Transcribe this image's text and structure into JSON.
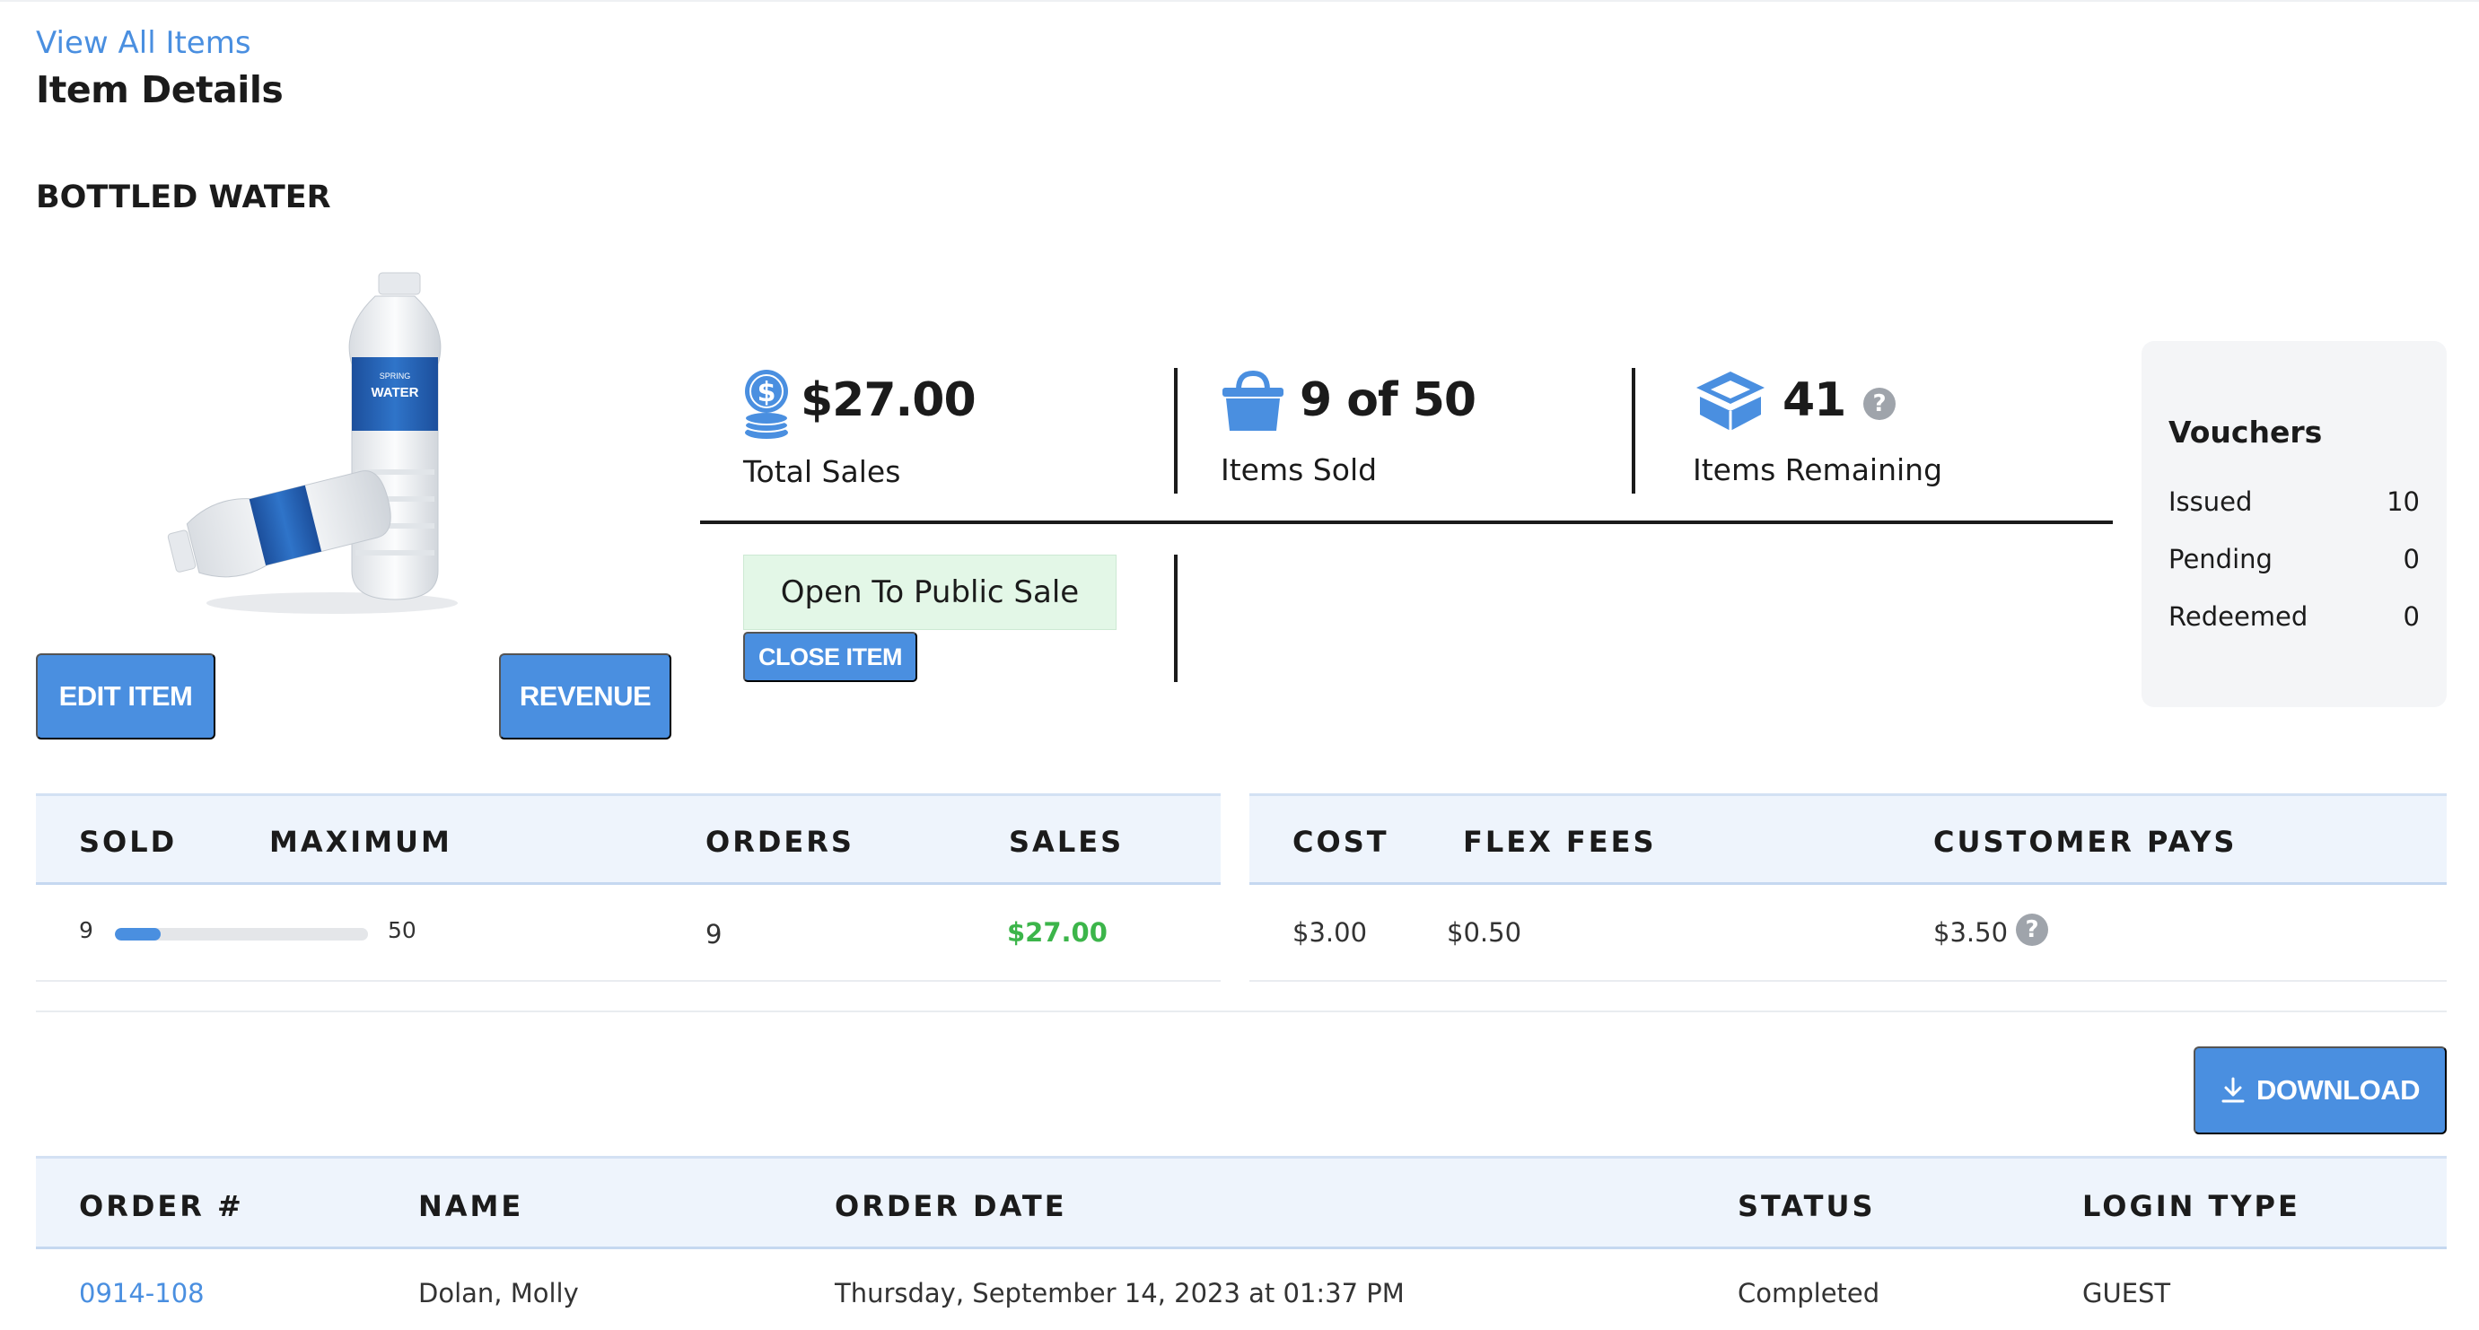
{
  "header": {
    "back_link": "View All Items",
    "title": "Item Details",
    "item_name": "BOTTLED WATER"
  },
  "product_image": {
    "bottle_brand_small": "SPRING",
    "bottle_brand_large": "WATER"
  },
  "actions": {
    "edit": "EDIT ITEM",
    "revenue": "REVENUE",
    "close": "CLOSE ITEM",
    "download": "DOWNLOAD"
  },
  "stats": {
    "total_sales": {
      "value": "$27.00",
      "label": "Total Sales",
      "icon": "coins-dollar-icon"
    },
    "items_sold": {
      "value": "9 of 50",
      "label": "Items Sold",
      "icon": "basket-icon"
    },
    "items_remaining": {
      "value": "41",
      "label": "Items Remaining",
      "icon": "box-icon",
      "help": "?"
    }
  },
  "sale_status": "Open To Public Sale",
  "vouchers": {
    "title": "Vouchers",
    "rows": [
      {
        "label": "Issued",
        "value": "10"
      },
      {
        "label": "Pending",
        "value": "0"
      },
      {
        "label": "Redeemed",
        "value": "0"
      }
    ]
  },
  "sales_table": {
    "headers": [
      "SOLD",
      "MAXIMUM",
      "ORDERS",
      "SALES"
    ],
    "row": {
      "sold": "9",
      "maximum": "50",
      "orders": "9",
      "sales": "$27.00",
      "progress": 0.18
    }
  },
  "pricing_table": {
    "headers": [
      "COST",
      "FLEX FEES",
      "CUSTOMER PAYS"
    ],
    "row": {
      "cost": "$3.00",
      "flex_fees": "$0.50",
      "customer_pays": "$3.50",
      "help": "?"
    }
  },
  "orders_table": {
    "headers": [
      "ORDER #",
      "NAME",
      "ORDER DATE",
      "STATUS",
      "LOGIN TYPE"
    ],
    "rows": [
      {
        "order": "0914-108",
        "name": "Dolan, Molly",
        "date": "Thursday, September 14, 2023 at 01:37 PM",
        "status": "Completed",
        "login_type": "GUEST"
      }
    ]
  },
  "colors": {
    "accent": "#4a8fe0",
    "sales_green": "#3cb54a",
    "status_green_bg": "#e3f7e7"
  }
}
